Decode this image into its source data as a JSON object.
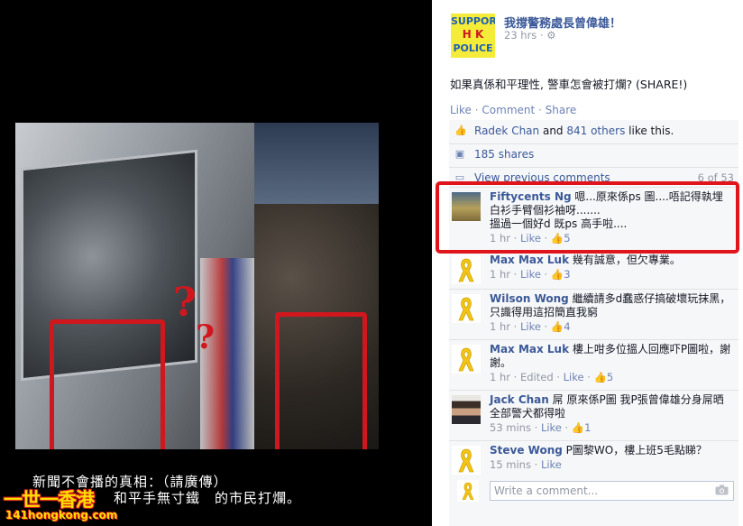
{
  "photo": {
    "caption_line1": "新聞不會播的真相：（請廣傳）",
    "caption_line2": "和平手無寸鐵　的市民打爛。",
    "watermark_main": "一世一香港",
    "watermark_url": "141hongkong.com"
  },
  "post": {
    "page_avatar": {
      "line1": "SUPPORT",
      "line2": "H  K",
      "line3": "POLICE"
    },
    "page_name": "我撐警務處長曾偉雄！",
    "time": "23 hrs",
    "text": "如果真係和平理性, 警車怎會被打爛? (SHARE!)",
    "actions": {
      "like": "Like",
      "comment": "Comment",
      "share": "Share"
    }
  },
  "ufi": {
    "likes": {
      "first": "Radek Chan",
      "and": "and",
      "others": "841 others",
      "suffix": "like this."
    },
    "shares": "185 shares",
    "view_previous": "View previous comments",
    "count": "6 of 53"
  },
  "comments": [
    {
      "name": "Fiftycents Ng",
      "text": "嗯...原來係ps 圖....唔記得執埋白衫手臂個衫袖呀.......\n搵過一個好d 既ps 高手啦....",
      "time": "1 hr",
      "like": "Like",
      "likes": "5",
      "edited": ""
    },
    {
      "name": "Max Max Luk",
      "text": "幾有誠意，但欠專業。",
      "time": "1 hr",
      "like": "Like",
      "likes": "3",
      "edited": ""
    },
    {
      "name": "Wilson Wong",
      "text": "繼續請多d蠢惑仔搞破壞玩抹黑，只識得用這招簡直我窮",
      "time": "1 hr",
      "like": "Like",
      "likes": "4",
      "edited": ""
    },
    {
      "name": "Max Max Luk",
      "text": "樓上咁多位搵人回應吓P圖啦，謝謝。",
      "time": "1 hr",
      "like": "Like",
      "likes": "5",
      "edited": "Edited"
    },
    {
      "name": "Jack Chan",
      "text": "屌 原來係P圖 我P張曾偉雄分身屌晒全部警犬都得啦",
      "time": "53 mins",
      "like": "Like",
      "likes": "1",
      "edited": ""
    },
    {
      "name": "Steve Wong",
      "text": "P圖黎WO，樓上班5毛點睇？",
      "time": "15 mins",
      "like": "Like",
      "likes": "",
      "edited": ""
    }
  ],
  "write_comment": {
    "placeholder": "Write a comment..."
  },
  "colors": {
    "fb_link": "#3b5998",
    "fb_meta": "#9197a3",
    "highlight_red": "#e0141b",
    "ribbon_yellow": "#f2c418"
  }
}
